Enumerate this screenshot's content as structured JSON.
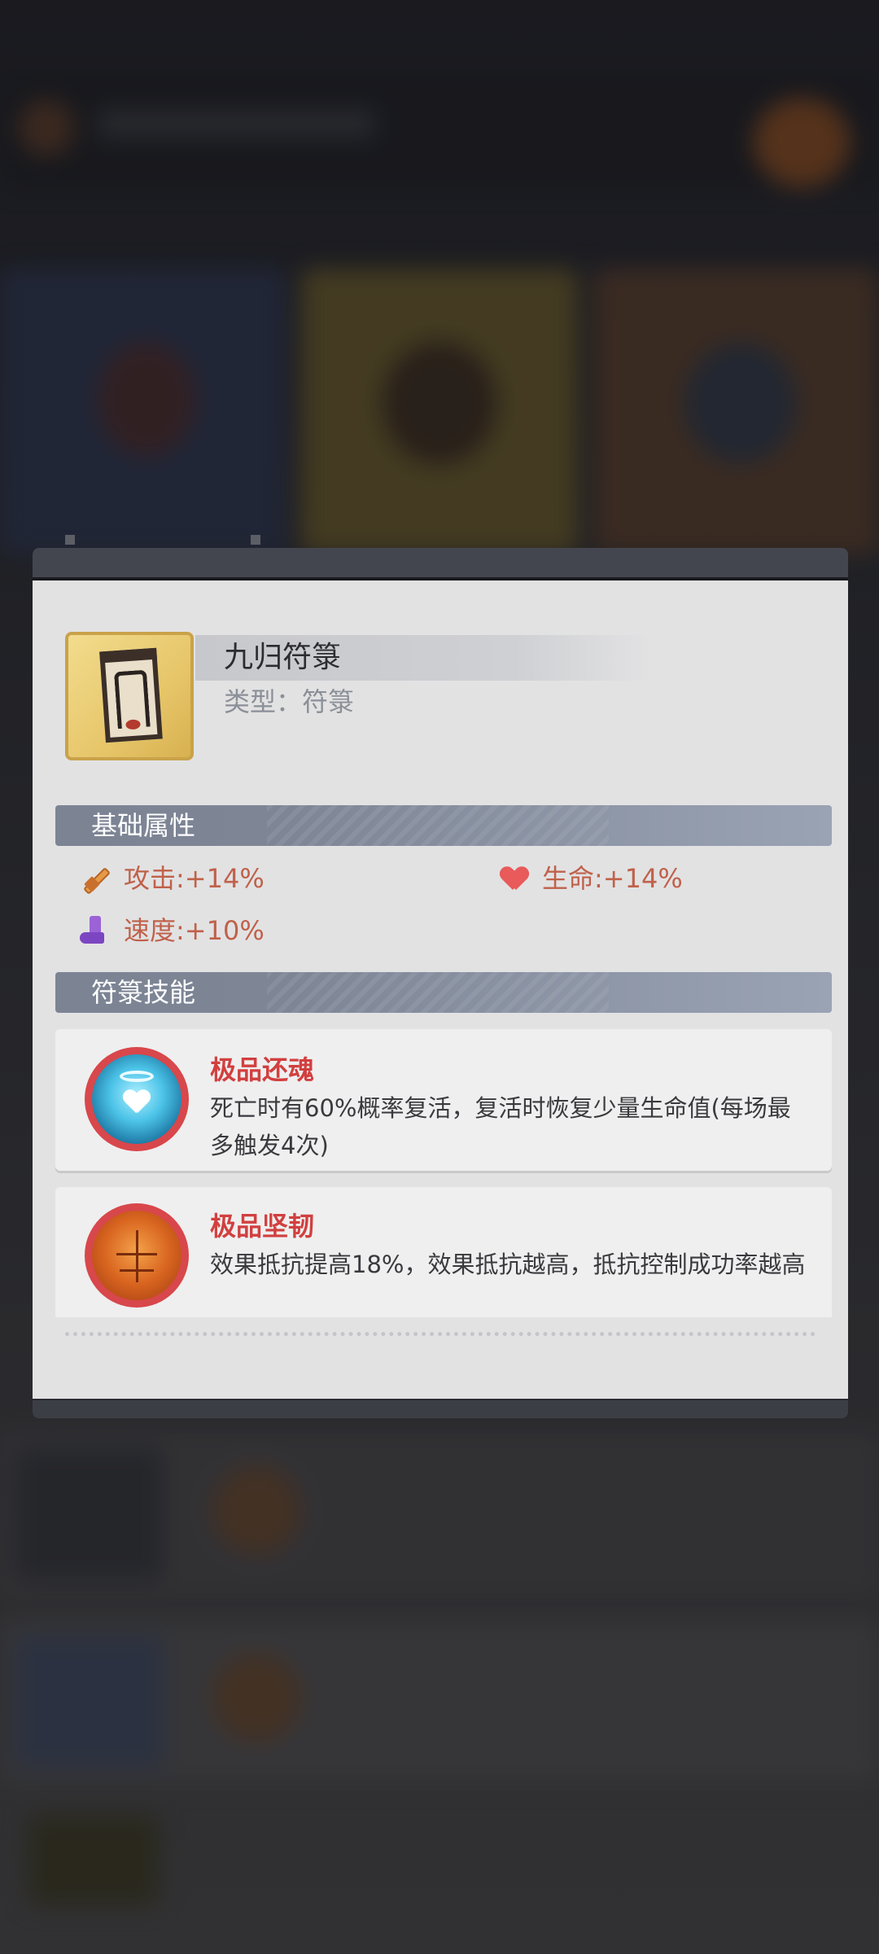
{
  "item": {
    "name": "九归符箓",
    "type_line": "类型：符箓",
    "icon": "talisman-scroll-icon",
    "frame_color": "#e7c66a"
  },
  "base_attributes": {
    "header": "基础属性",
    "stats": [
      {
        "icon": "sword-icon",
        "text": "攻击:+14%"
      },
      {
        "icon": "heart-icon",
        "text": "生命:+14%"
      },
      {
        "icon": "boot-icon",
        "text": "速度:+10%"
      }
    ]
  },
  "talisman_skills": {
    "header": "符箓技能",
    "skills": [
      {
        "icon": "angel-heart-icon",
        "title": "极品还魂",
        "description": "死亡时有60%概率复活，复活时恢复少量生命值(每场最多触发4次)"
      },
      {
        "icon": "armor-torso-icon",
        "title": "极品坚韧",
        "description": "效果抵抗提高18%，效果抵抗越高，抵抗控制成功率越高"
      }
    ]
  },
  "colors": {
    "stat_text": "#c0614a",
    "skill_title": "#d23f3f",
    "section_header": "#7c8494",
    "panel_bg": "#e2e2e3"
  }
}
